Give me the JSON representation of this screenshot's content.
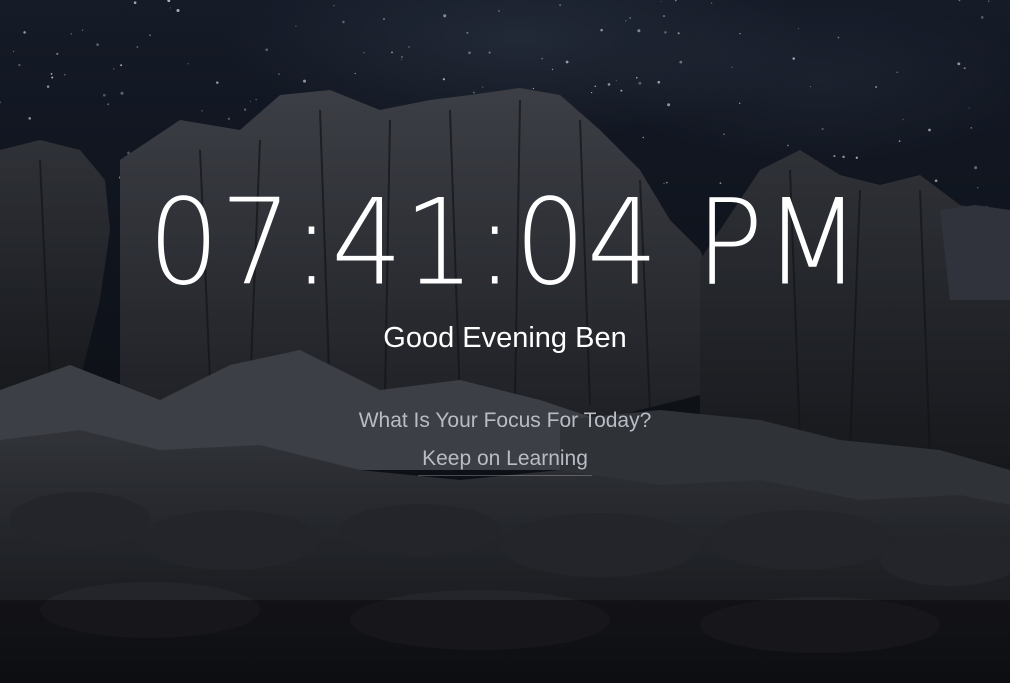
{
  "clock": {
    "time": "07:41:04 PM"
  },
  "greeting": {
    "text": "Good Evening Ben"
  },
  "focus": {
    "question": "What Is Your Focus For Today?",
    "answer": "Keep on Learning"
  },
  "colors": {
    "text_primary": "#ffffff",
    "text_secondary": "#b8bcc4",
    "background_sky": "#141a26",
    "background_rock": "#2a2d33"
  },
  "background": {
    "scene": "starry-night-rocky-mountains"
  }
}
